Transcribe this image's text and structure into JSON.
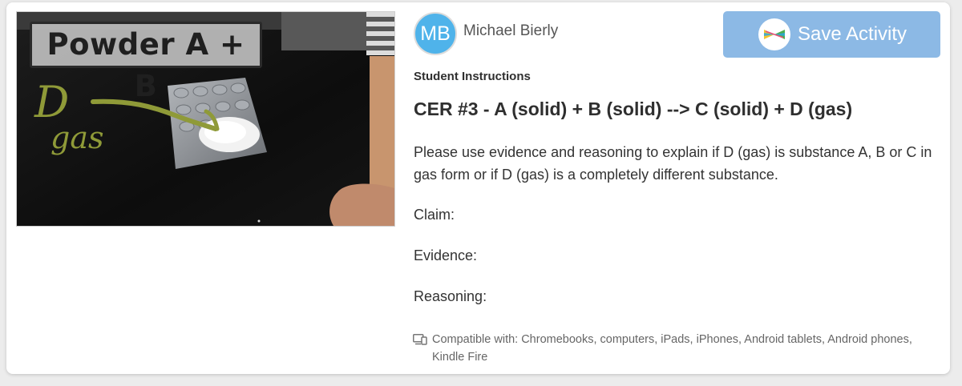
{
  "video": {
    "caption": "Powder A + B",
    "annotation_letter": "D",
    "annotation_word": "gas"
  },
  "author": {
    "initials": "MB",
    "name": "Michael Bierly",
    "avatar_color": "#4fb3ea"
  },
  "save_button": {
    "label": "Save Activity",
    "color": "#8cb9e5",
    "icon": "seesaw-logo-icon"
  },
  "instructions": {
    "section_label": "Student Instructions",
    "title": "CER #3 - A (solid) + B (solid) --> C (solid) + D (gas)",
    "body": "Please use evidence and reasoning to explain if D (gas) is substance A, B or C in gas form or if D (gas) is a completely different substance.",
    "prompts": {
      "claim": "Claim:",
      "evidence": "Evidence:",
      "reasoning": "Reasoning:"
    }
  },
  "compatibility": {
    "icon": "devices-icon",
    "text": "Compatible with: Chromebooks, computers, iPads, iPhones, Android tablets, Android phones, Kindle Fire"
  }
}
